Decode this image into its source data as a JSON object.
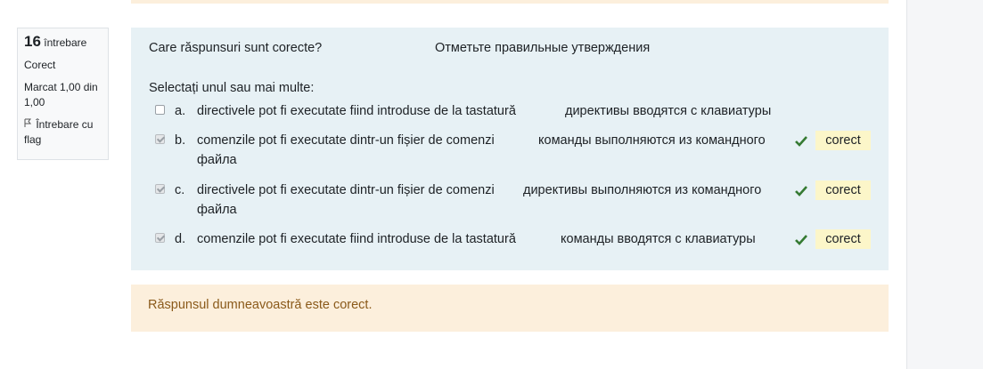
{
  "info": {
    "number": "16",
    "label": "întrebare",
    "status": "Corect",
    "marks": "Marcat 1,00 din 1,00",
    "flag_label": "Întrebare cu flag"
  },
  "question": {
    "text_ro": "Care răspunsuri sunt corecte?",
    "text_ru": "Отметьте правильные утверждения",
    "prompt": "Selectați unul sau mai multe:"
  },
  "options": [
    {
      "letter": "a.",
      "ro": "directivele pot fi executate fiind introduse de la tastatură",
      "ru": "директивы вводятся с клавиатуры",
      "ru2": "",
      "checked": false,
      "feedback": ""
    },
    {
      "letter": "b.",
      "ro": "comenzile pot fi executate dintr-un fișier de comenzi",
      "ru": "команды выполняются  из командного",
      "ru2": "файла",
      "checked": true,
      "feedback": "corect"
    },
    {
      "letter": "c.",
      "ro": "directivele pot fi executate dintr-un fișier de comenzi",
      "ru": "директивы выполняются  из командного",
      "ru2": "файла",
      "checked": true,
      "feedback": "corect"
    },
    {
      "letter": "d.",
      "ro": "comenzile pot fi executate fiind introduse de la tastatură",
      "ru": "команды вводятся с клавиатуры",
      "ru2": "",
      "checked": true,
      "feedback": "corect"
    }
  ],
  "feedback": {
    "text": "Răspunsul dumneavoastră este corect."
  },
  "colors": {
    "content_bg": "#e7f1f5",
    "feedback_bg": "#fcefdc",
    "badge_bg": "#fcf6c9",
    "check_green": "#357a32"
  }
}
